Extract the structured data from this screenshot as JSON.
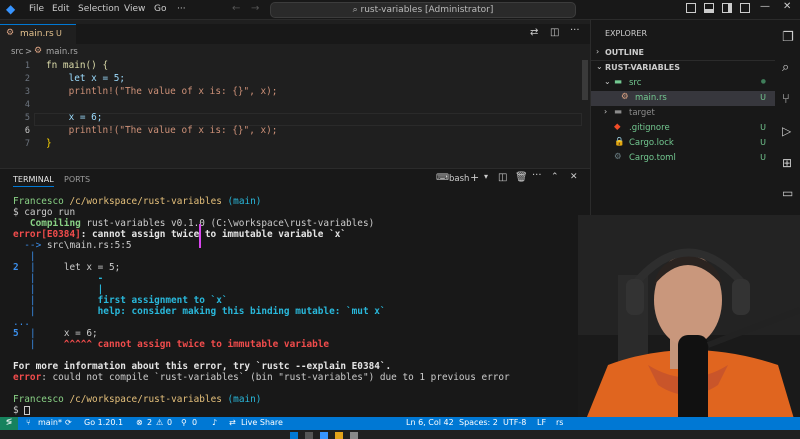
{
  "menu": {
    "file": "File",
    "edit": "Edit",
    "selection": "Selection",
    "view": "View",
    "go": "Go",
    "more": "···"
  },
  "command_center": {
    "text": "rust-variables [Administrator]"
  },
  "tab": {
    "label": "main.rs",
    "badge": "U"
  },
  "breadcrumb": {
    "folder": "src",
    "sep": ">",
    "file": "main.rs"
  },
  "editor": {
    "line_numbers": [
      "1",
      "2",
      "3",
      "4",
      "5",
      "6",
      "7"
    ],
    "lines": [
      "fn main() {",
      "    let x = 5;",
      "    println!(\"The value of x is: {}\", x);",
      "",
      "    x = 6;",
      "    println!(\"The value of x is: {}\", x);",
      "}"
    ]
  },
  "panel": {
    "tab_terminal": "TERMINAL",
    "tab_ports": "PORTS",
    "shell": "bash"
  },
  "terminal": {
    "prompt_user": "Francesco",
    "prompt_path": "/c/workspace/rust-variables",
    "prompt_branch": "(main)",
    "cmd": "$ cargo run",
    "compiling_kw": "   Compiling",
    "compiling_rest": " rust-variables v0.1.0 (C:\\workspace\\rust-variables)",
    "error_code": "error[E0384]",
    "error_msg": ": cannot assign twice to immutable variable `x`",
    "arrow": "  -->",
    "location": " src\\main.rs:5:5",
    "pipe1": "   |",
    "ln2": "2",
    "code2": "     let x = 5;",
    "pipe2": "   |",
    "dash": "           -",
    "pipe3": "   |",
    "bar": "           |",
    "pipe4": "   |",
    "first": "           first assignment to `x`",
    "pipe5": "   |",
    "help": "           help: consider making this binding mutable: `mut x`",
    "dots": "...",
    "ln5": "5",
    "code5": "     x = 6;",
    "pipe6": "   |",
    "carets": "     ^^^^^ cannot assign twice to immutable variable",
    "more_info": "For more information about this error, try `rustc --explain E0384`.",
    "error2_kw": "error",
    "error2_msg": ": could not compile `rust-variables` (bin \"rust-variables\") due to 1 previous error",
    "prompt2_user": "Francesco",
    "prompt2_path": "/c/workspace/rust-variables",
    "prompt2_branch": "(main)",
    "prompt2": "$ "
  },
  "explorer": {
    "title": "EXPLORER",
    "outline": "OUTLINE",
    "project": "RUST-VARIABLES",
    "items": [
      {
        "label": "src",
        "badge": "●"
      },
      {
        "label": "main.rs",
        "badge": "U"
      },
      {
        "label": "target",
        "badge": ""
      },
      {
        "label": ".gitignore",
        "badge": "U"
      },
      {
        "label": "Cargo.lock",
        "badge": "U"
      },
      {
        "label": "Cargo.toml",
        "badge": "U"
      }
    ]
  },
  "status": {
    "branch": "main*",
    "go": "Go 1.20.1",
    "errors": "2",
    "warnings": "0",
    "ports": "0",
    "live": "Live Share",
    "position": "Ln 6, Col 42",
    "spaces": "Spaces: 2",
    "encoding": "UTF-8",
    "eol": "LF",
    "lang": "rs"
  }
}
